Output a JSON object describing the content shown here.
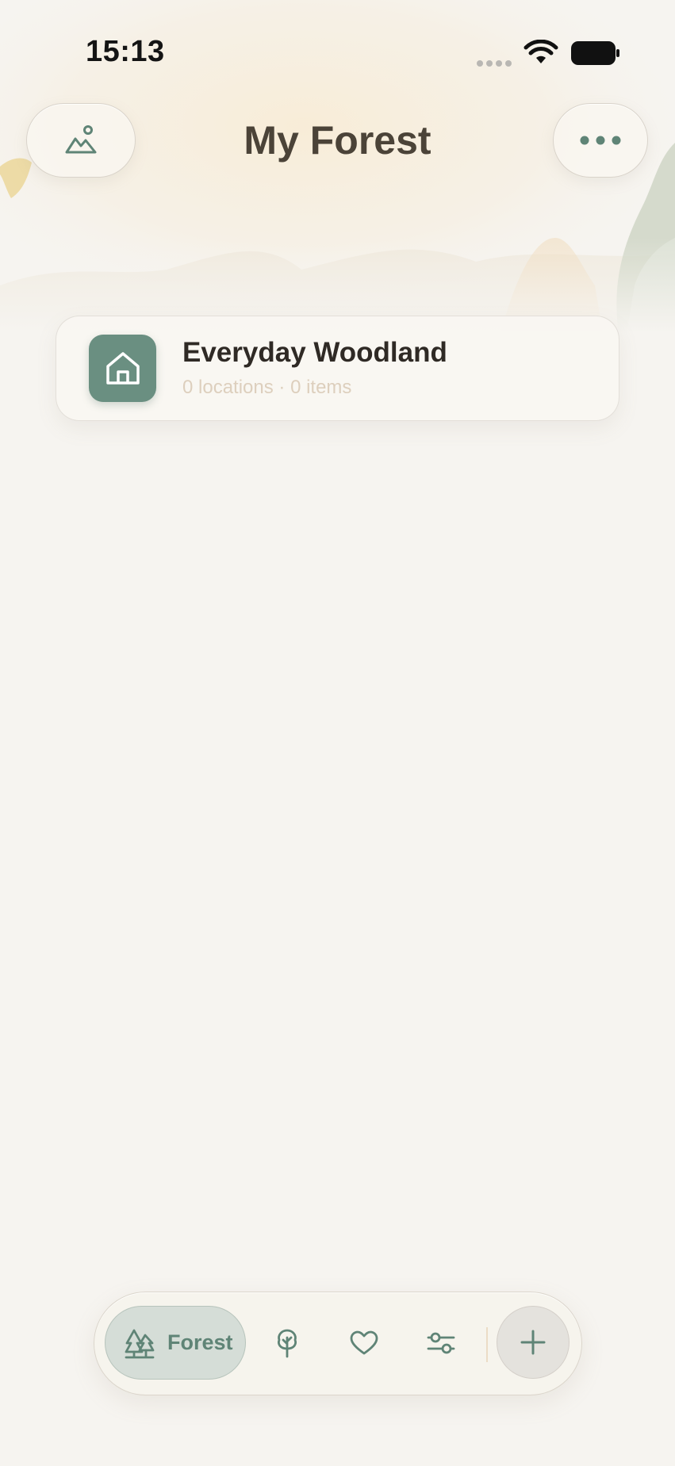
{
  "status_bar": {
    "time": "15:13"
  },
  "header": {
    "title": "My Forest",
    "left_button_icon": "landscape-icon",
    "right_button_icon": "more-icon"
  },
  "forests": [
    {
      "name": "Everyday Woodland",
      "summary": "0 locations · 0 items",
      "icon": "home-icon"
    }
  ],
  "tab_bar": {
    "active_tab": {
      "label": "Forest",
      "icon": "trees-icon"
    },
    "tabs": [
      {
        "icon": "tree-icon"
      },
      {
        "icon": "heart-icon"
      },
      {
        "icon": "sliders-icon"
      }
    ],
    "add_icon": "plus-icon"
  },
  "colors": {
    "background": "#f6f4f0",
    "accent_green": "#6a8f81",
    "title": "#4b4338",
    "subtitle": "#ddcfbd"
  }
}
